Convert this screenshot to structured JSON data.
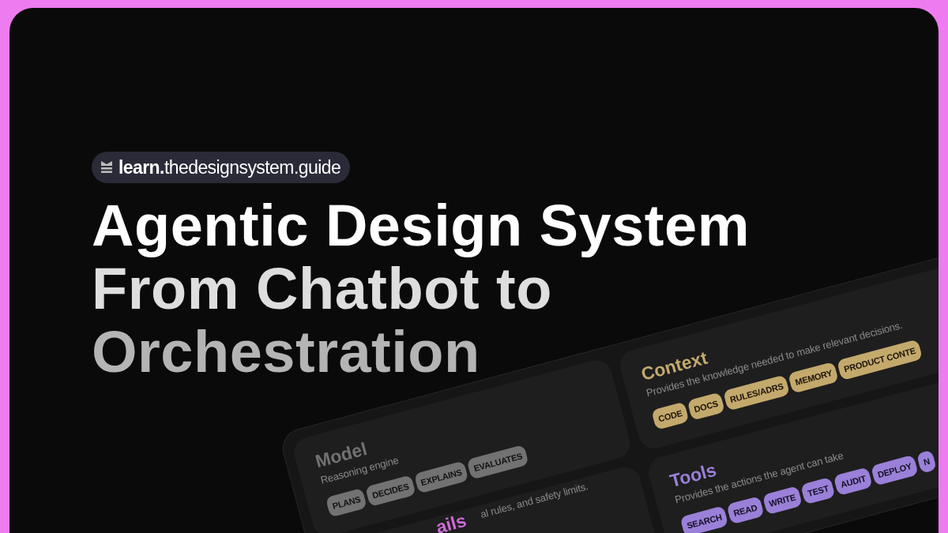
{
  "badge": {
    "bold": "learn.",
    "text": "thedesignsystem.guide"
  },
  "title_lines": [
    "Agentic Design System",
    "From Chatbot to",
    "Orchestration"
  ],
  "cards": [
    {
      "kind": "model",
      "title": "Model",
      "description": "Reasoning engine",
      "color": "#727272",
      "tags": [
        "PLANS",
        "DECIDES",
        "EXPLAINS",
        "EVALUATES"
      ]
    },
    {
      "kind": "context",
      "title": "Context",
      "description": "Provides the knowledge needed to make relevant decisions.",
      "color": "#c4a96c",
      "tags": [
        "CODE",
        "DOCS",
        "RULES/ADRS",
        "MEMORY",
        "PRODUCT CONTE"
      ]
    },
    {
      "kind": "guardrails",
      "title": "ails",
      "description": "al rules, and safety limits.",
      "color": "#cc6ad8"
    },
    {
      "kind": "tools",
      "title": "Tools",
      "description": "Provides the actions the agent can take",
      "color": "#9a80d8",
      "tags": [
        "SEARCH",
        "READ",
        "WRITE",
        "TEST",
        "AUDIT",
        "DEPLOY",
        "N"
      ]
    }
  ]
}
